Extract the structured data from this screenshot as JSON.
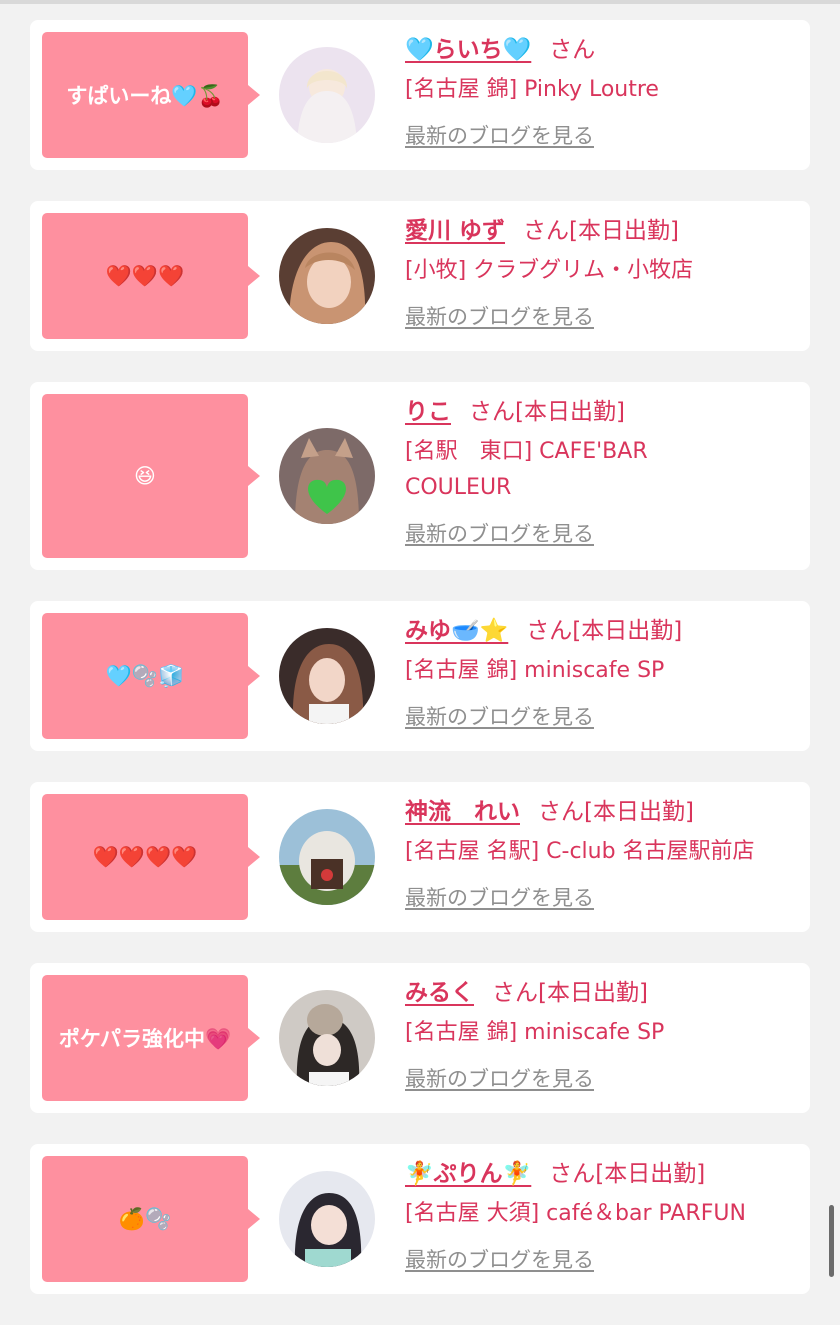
{
  "entries": [
    {
      "bubble": "すぱいーね🩵🍒",
      "name": "🩵らいち🩵",
      "suffix": "さん",
      "shop": "[名古屋 錦] Pinky Loutre",
      "blog": "最新のブログを見る"
    },
    {
      "bubble": "❤️❤️❤️",
      "name": "愛川 ゆず",
      "suffix": "さん[本日出勤]",
      "shop": "[小牧] クラブグリム・小牧店",
      "blog": "最新のブログを見る"
    },
    {
      "bubble": "😆",
      "name": "りこ",
      "suffix": "さん[本日出勤]",
      "shop": "[名駅　東口] CAFE'BAR COULEUR",
      "blog": "最新のブログを見る"
    },
    {
      "bubble": "🩵🫧🧊",
      "name": "みゆ🥣⭐",
      "suffix": "さん[本日出勤]",
      "shop": "[名古屋 錦] miniscafe SP",
      "blog": "最新のブログを見る"
    },
    {
      "bubble": "❤️❤️❤️❤️",
      "name": "神流　れい",
      "suffix": "さん[本日出勤]",
      "shop": "[名古屋 名駅] C-club 名古屋駅前店",
      "blog": "最新のブログを見る"
    },
    {
      "bubble": "ポケパラ強化中💗",
      "name": "みるく",
      "suffix": "さん[本日出勤]",
      "shop": "[名古屋 錦] miniscafe SP",
      "blog": "最新のブログを見る"
    },
    {
      "bubble": "🍊🫧",
      "name": "🧚ぷりん🧚",
      "suffix": "さん[本日出勤]",
      "shop": "[名古屋 大須] café＆bar PARFUN",
      "blog": "最新のブログを見る"
    }
  ],
  "avatar_colors": [
    "#e8dcea",
    "#c9a07f",
    "#8a7268",
    "#6b4f45",
    "#7a9a6a",
    "#b8b0a8",
    "#d9dde8"
  ]
}
